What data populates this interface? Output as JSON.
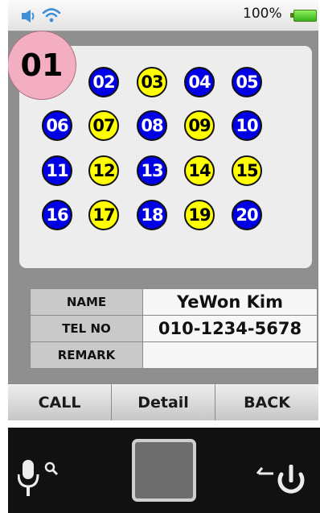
{
  "status": {
    "battery_percent": "100%",
    "battery_level": 1.0,
    "icons": [
      "speaker-icon",
      "wifi-icon",
      "battery-icon"
    ]
  },
  "numbers": [
    {
      "label": "01",
      "color": "pink",
      "selected": true
    },
    {
      "label": "02",
      "color": "blue"
    },
    {
      "label": "03",
      "color": "yellow"
    },
    {
      "label": "04",
      "color": "blue"
    },
    {
      "label": "05",
      "color": "blue"
    },
    {
      "label": "06",
      "color": "blue"
    },
    {
      "label": "07",
      "color": "yellow"
    },
    {
      "label": "08",
      "color": "blue"
    },
    {
      "label": "09",
      "color": "yellow"
    },
    {
      "label": "10",
      "color": "blue"
    },
    {
      "label": "11",
      "color": "blue"
    },
    {
      "label": "12",
      "color": "yellow"
    },
    {
      "label": "13",
      "color": "blue"
    },
    {
      "label": "14",
      "color": "yellow"
    },
    {
      "label": "15",
      "color": "yellow"
    },
    {
      "label": "16",
      "color": "blue"
    },
    {
      "label": "17",
      "color": "yellow"
    },
    {
      "label": "18",
      "color": "blue"
    },
    {
      "label": "19",
      "color": "yellow"
    },
    {
      "label": "20",
      "color": "blue"
    }
  ],
  "colors": {
    "blue": "#0000e6",
    "yellow": "#ffff00",
    "pink": "#f4aec2"
  },
  "info": {
    "name_label": "NAME",
    "name_value": "YeWon Kim",
    "tel_label": "TEL NO",
    "tel_value": "010-1234-5678",
    "remark_label": "REMARK",
    "remark_value": ""
  },
  "buttons": {
    "call": "CALL",
    "detail": "Detail",
    "back": "BACK"
  },
  "navbar": {
    "icons": [
      "voice-search-icon",
      "home-button",
      "power-back-icon"
    ]
  }
}
